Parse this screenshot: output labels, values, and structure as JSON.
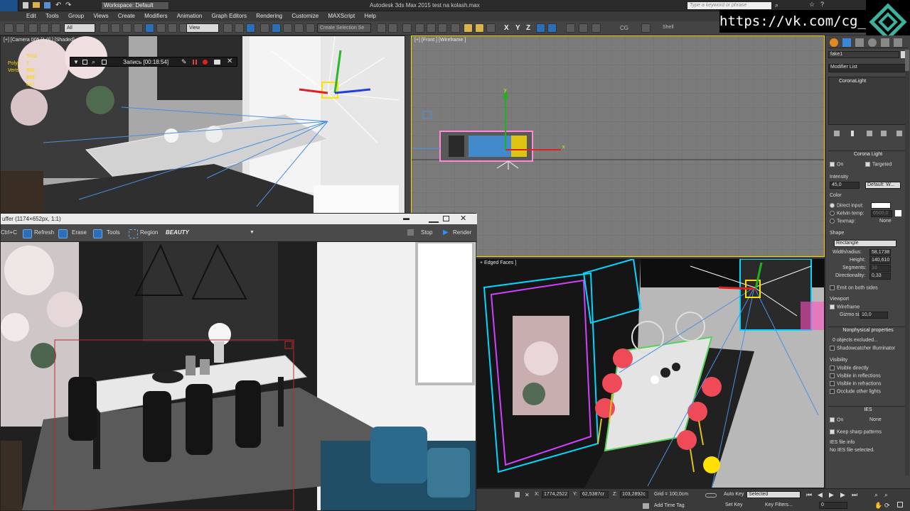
{
  "app": {
    "workspace": "Workspace: Default",
    "title": "Autodesk 3ds Max 2015    test na kolash.max",
    "search_placeholder": "Type a keyword or phrase"
  },
  "menu": [
    "Edit",
    "Tools",
    "Group",
    "Views",
    "Create",
    "Modifiers",
    "Animation",
    "Graph Editors",
    "Rendering",
    "Customize",
    "MAXScript",
    "Help"
  ],
  "toolbar": {
    "filter": "All",
    "ref_coord": "View",
    "selection_set": "Create Selection Se",
    "axis_x": "X",
    "axis_y": "Y",
    "axis_z": "Z",
    "cg": "CG",
    "shell": "Shell"
  },
  "overlay_url": "https://vk.com/cg_bandit",
  "viewports": {
    "camera": {
      "label": "[+] [Camera 005 [1,0] ] [Shaded]",
      "stats_total": "Total",
      "polys_label": "Polys:",
      "polys": "7 798 563",
      "verts_label": "Verts:",
      "verts": "5 438 641"
    },
    "front": {
      "label": "[+] [Front ] [Wireframe ]"
    },
    "perspective": {
      "label": "+ Edged Faces ]"
    }
  },
  "recording": {
    "label": "Запись [00:18:54]"
  },
  "vfb": {
    "title": "uffer (1174×652px, 1:1)",
    "copy": "Ctrl+C",
    "refresh": "Refresh",
    "erase": "Erase",
    "tools": "Tools",
    "region": "Region",
    "channel": "BEAUTY",
    "stop": "Stop",
    "render": "Render"
  },
  "command_panel": {
    "object_name": "fake1",
    "modifier_list": "Modifier List",
    "stack_item": "CoronaLight",
    "rollout_title": "Corona Light",
    "on": "On",
    "targeted": "Targeted",
    "intensity_label": "Intensity",
    "intensity": "45,0",
    "intensity_unit": "Default: W...",
    "color_label": "Color",
    "direct_input": "Direct input:",
    "kelvin": "Kelvin temp:",
    "kelvin_value": "6500,0",
    "texmap": "Texmap:",
    "texmap_value": "None",
    "shape_label": "Shape",
    "shape": "Rectangle",
    "width_label": "Width/radius:",
    "width": "58,1738",
    "height_label": "Height:",
    "height": "140,610",
    "segments_label": "Segments:",
    "segments": "10",
    "directionality_label": "Directionality:",
    "directionality": "0,33",
    "emit_both": "Emit on both sides",
    "viewport_label": "Viewport",
    "wireframe": "Wireframe",
    "gizmo_label": "Gizmo size:",
    "gizmo": "10,0",
    "nonphys": "Nonphysical properties",
    "excluded": "0 objects excluded...",
    "shadowcatcher": "Shadowcatcher illuminator",
    "visibility_label": "Visibility",
    "vis_directly": "Visible directly",
    "vis_reflections": "Visible in reflections",
    "vis_refractions": "Visible in refractions",
    "occlude": "Occlude other lights",
    "ies_title": "IES",
    "ies_on": "On",
    "ies_none": "None",
    "keep_sharp": "Keep sharp patterns",
    "ies_file_info": "IES file info",
    "ies_no_file": "No IES file selected."
  },
  "status": {
    "x_label": "X:",
    "x": "1774,2522",
    "y_label": "Y:",
    "y": "62,5387cr",
    "z_label": "Z:",
    "z": "103,2892c",
    "grid": "Grid = 100,0cm",
    "autokey": "Auto Key",
    "selected": "Selected",
    "setkey": "Set Key",
    "key_filters": "Key Filters...",
    "add_time_tag": "Add Time Tag",
    "frame": "0"
  },
  "colors": {
    "accent": "#2a6fb8",
    "selection": "#ffe000",
    "viewport_bg": "#7f7f7f"
  }
}
